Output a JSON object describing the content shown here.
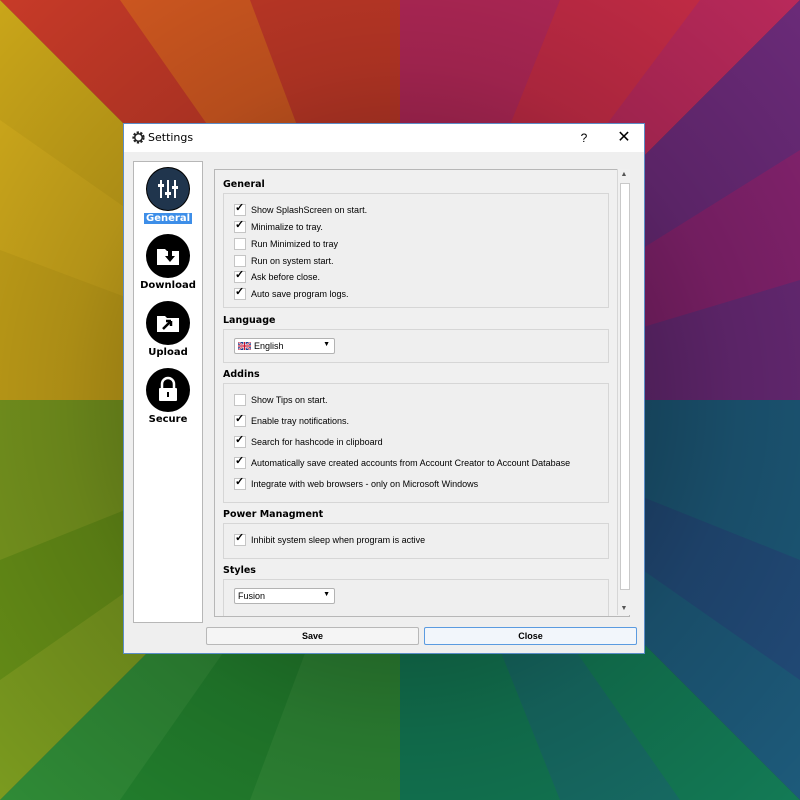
{
  "colors": {
    "accent": "#3d8ee8",
    "window_border": "#5b8dc7"
  },
  "window": {
    "title": "Settings",
    "app_icon": "gear-icon",
    "help_label": "?",
    "close_label": "✕"
  },
  "sidebar": {
    "items": [
      {
        "label": "General",
        "icon": "sliders-icon",
        "active": true
      },
      {
        "label": "Download",
        "icon": "download-folder-icon",
        "active": false
      },
      {
        "label": "Upload",
        "icon": "upload-folder-icon",
        "active": false
      },
      {
        "label": "Secure",
        "icon": "lock-icon",
        "active": false
      }
    ]
  },
  "general": {
    "title": "General",
    "options": [
      {
        "label": "Show SplashScreen on start.",
        "checked": true
      },
      {
        "label": "Minimalize to tray.",
        "checked": true
      },
      {
        "label": "Run Minimized to tray",
        "checked": false
      },
      {
        "label": "Run on system start.",
        "checked": false
      },
      {
        "label": "Ask before close.",
        "checked": true
      },
      {
        "label": "Auto save program logs.",
        "checked": true
      }
    ]
  },
  "language": {
    "title": "Language",
    "selected": "English",
    "flag": "uk-flag-icon"
  },
  "addins": {
    "title": "Addins",
    "options": [
      {
        "label": "Show Tips on start.",
        "checked": false
      },
      {
        "label": "Enable tray notifications.",
        "checked": true
      },
      {
        "label": "Search for hashcode in clipboard",
        "checked": true
      },
      {
        "label": "Automatically save created accounts from Account Creator to Account Database",
        "checked": true
      },
      {
        "label": "Integrate with web browsers  - only on Microsoft Windows",
        "checked": true
      }
    ]
  },
  "power": {
    "title": "Power Managment",
    "options": [
      {
        "label": "Inhibit system sleep when program is active",
        "checked": true
      }
    ]
  },
  "styles": {
    "title": "Styles",
    "selected": "Fusion"
  },
  "footer": {
    "save_label": "Save",
    "close_label": "Close"
  }
}
